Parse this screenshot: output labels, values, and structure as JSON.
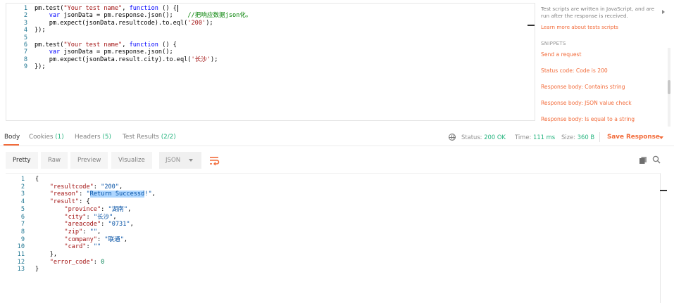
{
  "editor": {
    "lines": [
      {
        "n": "1",
        "parts": [
          [
            "plain",
            "pm.test("
          ],
          [
            "str",
            "\"Your test name\""
          ],
          [
            "plain",
            ", "
          ],
          [
            "kw",
            "function"
          ],
          [
            "plain",
            " () {"
          ]
        ]
      },
      {
        "n": "2",
        "parts": [
          [
            "plain",
            "    "
          ],
          [
            "kw",
            "var"
          ],
          [
            "plain",
            " jsonData = pm.response.json();    "
          ],
          [
            "cm",
            "//把响应数据json化。"
          ]
        ]
      },
      {
        "n": "3",
        "parts": [
          [
            "plain",
            "    pm.expect(jsonData.resultcode).to.eql("
          ],
          [
            "str",
            "'200'"
          ],
          [
            "plain",
            ");"
          ]
        ]
      },
      {
        "n": "4",
        "parts": [
          [
            "plain",
            "});"
          ]
        ]
      },
      {
        "n": "5",
        "parts": []
      },
      {
        "n": "6",
        "parts": [
          [
            "plain",
            "pm.test("
          ],
          [
            "str",
            "\"Your test name\""
          ],
          [
            "plain",
            ", "
          ],
          [
            "kw",
            "function"
          ],
          [
            "plain",
            " () {"
          ]
        ]
      },
      {
        "n": "7",
        "parts": [
          [
            "plain",
            "    "
          ],
          [
            "kw",
            "var"
          ],
          [
            "plain",
            " jsonData = pm.response.json();"
          ]
        ]
      },
      {
        "n": "8",
        "parts": [
          [
            "plain",
            "    pm.expect(jsonData.result.city).to.eql("
          ],
          [
            "str",
            "'长沙'"
          ],
          [
            "plain",
            ");"
          ]
        ]
      },
      {
        "n": "9",
        "parts": [
          [
            "plain",
            "});"
          ]
        ]
      }
    ]
  },
  "side_panel": {
    "help_text": "Test scripts are written in JavaScript, and are run after the response is received.",
    "learn_link": "Learn more about tests scripts",
    "snippets_heading": "SNIPPETS",
    "snippets": [
      "Send a request",
      "Status code: Code is 200",
      "Response body: Contains string",
      "Response body: JSON value check",
      "Response body: Is equal to a string"
    ]
  },
  "response_tabs": {
    "body": "Body",
    "cookies": "Cookies",
    "cookies_count": "(1)",
    "headers": "Headers",
    "headers_count": "(5)",
    "test_results": "Test Results",
    "test_results_count": "(2/2)"
  },
  "status_info": {
    "status_label": "Status:",
    "status_value": "200 OK",
    "time_label": "Time:",
    "time_value": "111 ms",
    "size_label": "Size:",
    "size_value": "360 B",
    "save_response": "Save Response"
  },
  "format_bar": {
    "pretty": "Pretty",
    "raw": "Raw",
    "preview": "Preview",
    "visualize": "Visualize",
    "format_selected": "JSON"
  },
  "colors": {
    "accent": "#f26b3a",
    "status_green": "#26b47f",
    "line_number": "#237893"
  },
  "icons": [
    "globe-icon",
    "chevron-down-icon",
    "wrap-lines-icon",
    "copy-icon",
    "search-icon",
    "chevron-right-icon"
  ],
  "response_body": {
    "lines": [
      {
        "n": "1",
        "parts": [
          [
            "plain",
            "{"
          ]
        ]
      },
      {
        "n": "2",
        "parts": [
          [
            "plain",
            "    "
          ],
          [
            "key",
            "\"resultcode\""
          ],
          [
            "plain",
            ": "
          ],
          [
            "str",
            "\"200\""
          ],
          [
            "plain",
            ","
          ]
        ]
      },
      {
        "n": "3",
        "parts": [
          [
            "plain",
            "    "
          ],
          [
            "key",
            "\"reason\""
          ],
          [
            "plain",
            ": "
          ],
          [
            "str",
            "\""
          ],
          [
            "hl",
            "Return Successd"
          ],
          [
            "str",
            "!\""
          ],
          [
            "plain",
            ","
          ]
        ]
      },
      {
        "n": "4",
        "parts": [
          [
            "plain",
            "    "
          ],
          [
            "key",
            "\"result\""
          ],
          [
            "plain",
            ": {"
          ]
        ]
      },
      {
        "n": "5",
        "parts": [
          [
            "plain",
            "        "
          ],
          [
            "key",
            "\"province\""
          ],
          [
            "plain",
            ": "
          ],
          [
            "str",
            "\"湖南\""
          ],
          [
            "plain",
            ","
          ]
        ]
      },
      {
        "n": "6",
        "parts": [
          [
            "plain",
            "        "
          ],
          [
            "key",
            "\"city\""
          ],
          [
            "plain",
            ": "
          ],
          [
            "str",
            "\"长沙\""
          ],
          [
            "plain",
            ","
          ]
        ]
      },
      {
        "n": "7",
        "parts": [
          [
            "plain",
            "        "
          ],
          [
            "key",
            "\"areacode\""
          ],
          [
            "plain",
            ": "
          ],
          [
            "str",
            "\"0731\""
          ],
          [
            "plain",
            ","
          ]
        ]
      },
      {
        "n": "8",
        "parts": [
          [
            "plain",
            "        "
          ],
          [
            "key",
            "\"zip\""
          ],
          [
            "plain",
            ": "
          ],
          [
            "str",
            "\"\""
          ],
          [
            "plain",
            ","
          ]
        ]
      },
      {
        "n": "9",
        "parts": [
          [
            "plain",
            "        "
          ],
          [
            "key",
            "\"company\""
          ],
          [
            "plain",
            ": "
          ],
          [
            "str",
            "\"联通\""
          ],
          [
            "plain",
            ","
          ]
        ]
      },
      {
        "n": "10",
        "parts": [
          [
            "plain",
            "        "
          ],
          [
            "key",
            "\"card\""
          ],
          [
            "plain",
            ": "
          ],
          [
            "str",
            "\"\""
          ]
        ]
      },
      {
        "n": "11",
        "parts": [
          [
            "plain",
            "    },"
          ]
        ]
      },
      {
        "n": "12",
        "parts": [
          [
            "plain",
            "    "
          ],
          [
            "key",
            "\"error_code\""
          ],
          [
            "plain",
            ": "
          ],
          [
            "num",
            "0"
          ]
        ]
      },
      {
        "n": "13",
        "parts": [
          [
            "plain",
            "}"
          ]
        ]
      }
    ]
  }
}
